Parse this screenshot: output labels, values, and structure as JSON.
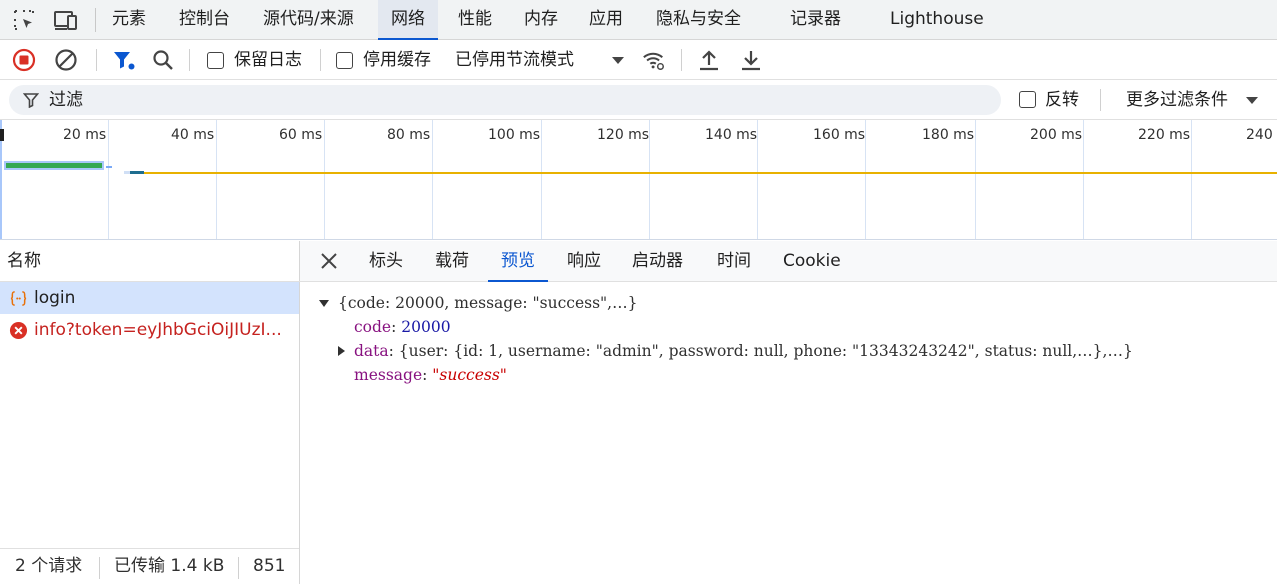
{
  "tabbar": {
    "tabs": [
      {
        "label": "元素"
      },
      {
        "label": "控制台"
      },
      {
        "label": "源代码/来源"
      },
      {
        "label": "网络"
      },
      {
        "label": "性能"
      },
      {
        "label": "内存"
      },
      {
        "label": "应用"
      },
      {
        "label": "隐私与安全"
      },
      {
        "label": "记录器"
      },
      {
        "label": "Lighthouse"
      }
    ],
    "active_tab": "网络",
    "accent": "#0b57d0"
  },
  "toolbar": {
    "preserve_log_label": "保留日志",
    "disable_cache_label": "停用缓存",
    "throttling_value": "已停用节流模式",
    "record_color": "#d93025",
    "filter_icon_color": "#0b57d0"
  },
  "filterbar": {
    "filter_placeholder": "过滤",
    "invert_label": "反转",
    "more_filters_label": "更多过滤条件"
  },
  "timeline": {
    "ticks": [
      "20 ms",
      "40 ms",
      "60 ms",
      "80 ms",
      "100 ms",
      "120 ms",
      "140 ms",
      "160 ms",
      "180 ms",
      "200 ms",
      "220 ms",
      "240"
    ]
  },
  "requests": {
    "header": "名称",
    "rows": [
      {
        "name": "login",
        "icon": "json-icon",
        "status": "ok"
      },
      {
        "name": "info?token=eyJhbGciOiJIUzI...",
        "icon": "error-icon",
        "status": "error"
      }
    ]
  },
  "status": {
    "count": "2 个请求",
    "transferred": "已传输 1.4 kB",
    "extra": "851"
  },
  "detail": {
    "tabs": [
      "标头",
      "载荷",
      "预览",
      "响应",
      "启动器",
      "时间",
      "Cookie"
    ],
    "active_tab": "预览"
  },
  "preview": {
    "summary": "{code: 20000, message: \"success\",…}",
    "code_key": "code",
    "code_value": "20000",
    "data_key": "data",
    "data_summary": "{user: {id: 1, username: \"admin\", password: null, phone: \"13343243242\", status: null,…},…}",
    "message_key": "message",
    "message_value": "\"success\""
  }
}
